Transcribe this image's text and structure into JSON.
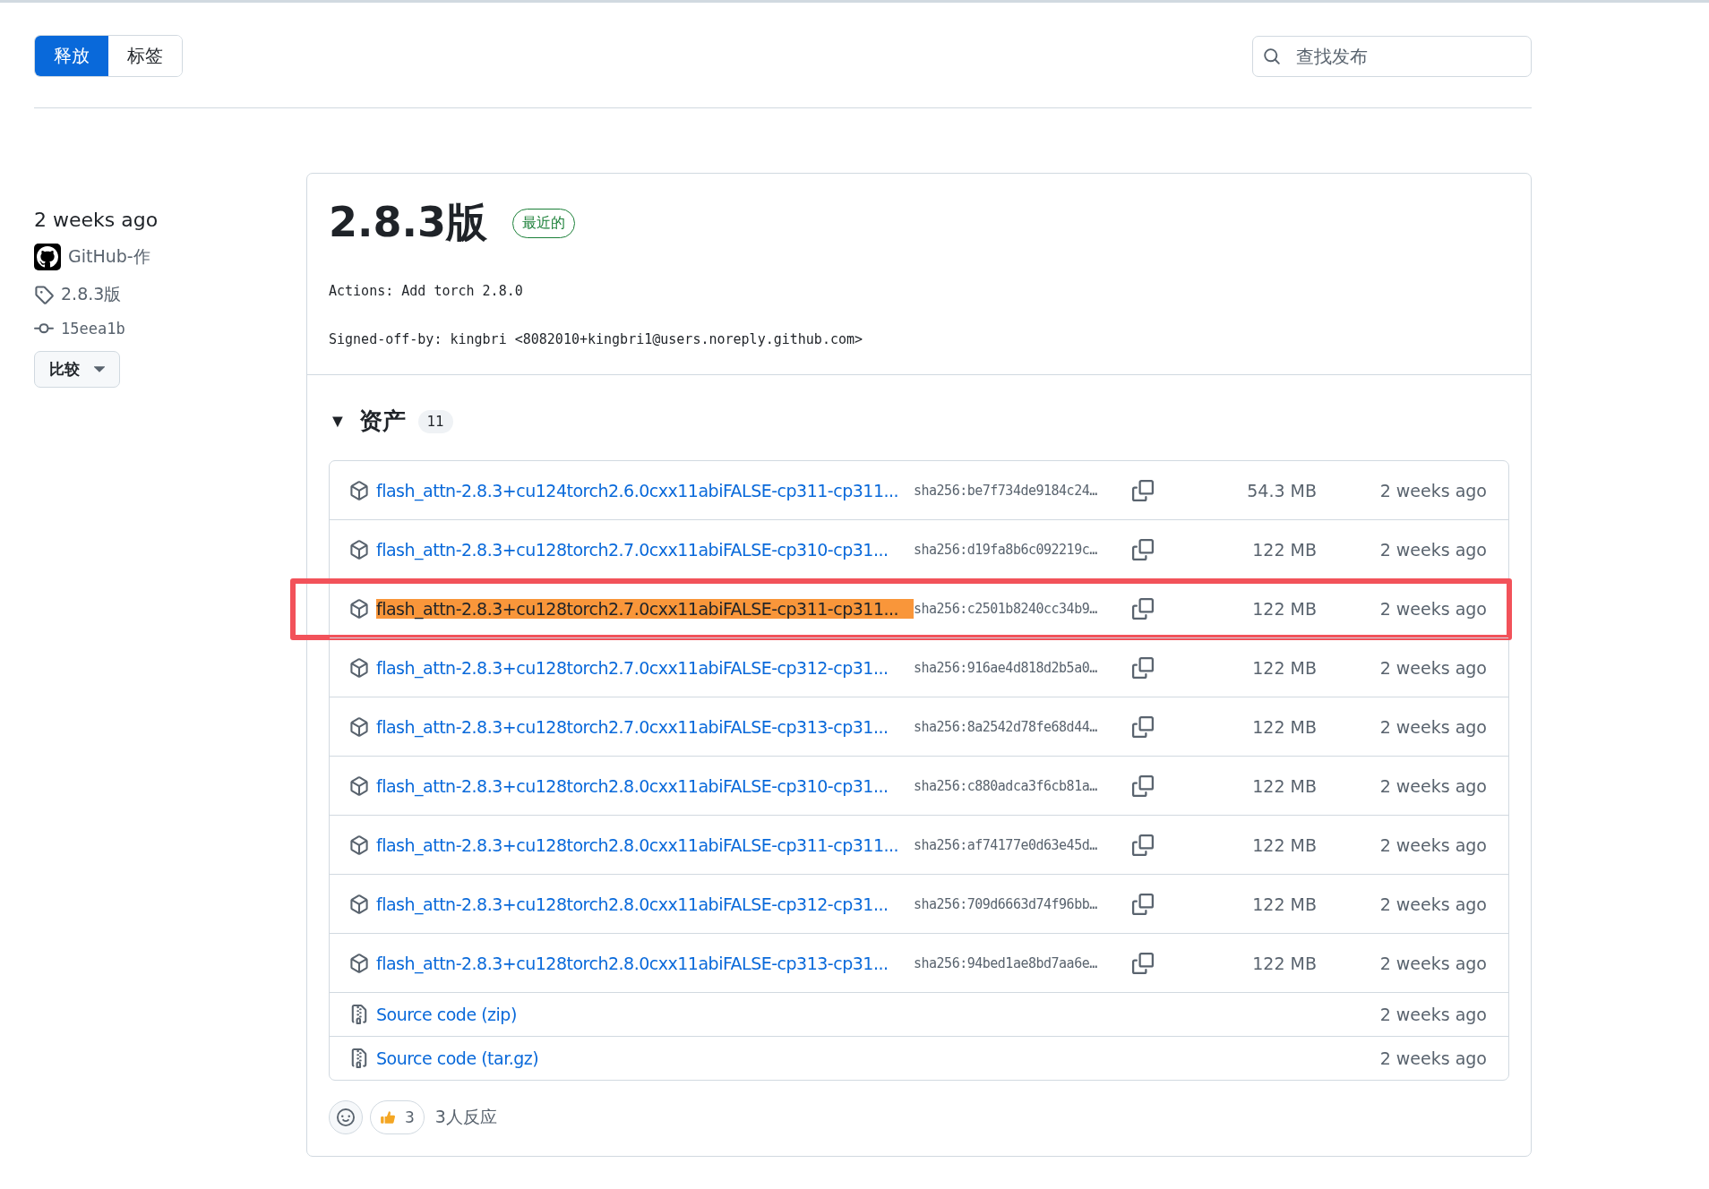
{
  "tabs": [
    {
      "label": "释放",
      "selected": true
    },
    {
      "label": "标签",
      "selected": false
    }
  ],
  "search": {
    "placeholder": "查找发布"
  },
  "sidebar": {
    "date": "2 weeks ago",
    "author": "GitHub-作",
    "tag": "2.8.3版",
    "commit": "15eea1b",
    "compare_button": "比较"
  },
  "release": {
    "title": "2.8.3版",
    "badge": "最近的",
    "body": [
      "Actions: Add torch 2.8.0",
      "Signed-off-by: kingbri <8082010+kingbri1@users.noreply.github.com>"
    ],
    "assets": {
      "toggle": "▼",
      "heading": "资产",
      "count": "11",
      "items": [
        {
          "kind": "package",
          "name": "flash_attn-2.8.3+cu124torch2.6.0cxx11abiFALSE-cp311-cp311...",
          "hash": "sha256:be7f734de9184c24…",
          "size": "54.3 MB",
          "time": "2 weeks ago",
          "highlighted": false,
          "framed": false
        },
        {
          "kind": "package",
          "name": "flash_attn-2.8.3+cu128torch2.7.0cxx11abiFALSE-cp310-cp31...",
          "hash": "sha256:d19fa8b6c092219c…",
          "size": "122 MB",
          "time": "2 weeks ago",
          "highlighted": false,
          "framed": false
        },
        {
          "kind": "package",
          "name": "flash_attn-2.8.3+cu128torch2.7.0cxx11abiFALSE-cp311-cp311...",
          "hash": "sha256:c2501b8240cc34b9…",
          "size": "122 MB",
          "time": "2 weeks ago",
          "highlighted": true,
          "framed": true
        },
        {
          "kind": "package",
          "name": "flash_attn-2.8.3+cu128torch2.7.0cxx11abiFALSE-cp312-cp31...",
          "hash": "sha256:916ae4d818d2b5a0…",
          "size": "122 MB",
          "time": "2 weeks ago",
          "highlighted": false,
          "framed": false
        },
        {
          "kind": "package",
          "name": "flash_attn-2.8.3+cu128torch2.7.0cxx11abiFALSE-cp313-cp31...",
          "hash": "sha256:8a2542d78fe68d44…",
          "size": "122 MB",
          "time": "2 weeks ago",
          "highlighted": false,
          "framed": false
        },
        {
          "kind": "package",
          "name": "flash_attn-2.8.3+cu128torch2.8.0cxx11abiFALSE-cp310-cp31...",
          "hash": "sha256:c880adca3f6cb81a…",
          "size": "122 MB",
          "time": "2 weeks ago",
          "highlighted": false,
          "framed": false
        },
        {
          "kind": "package",
          "name": "flash_attn-2.8.3+cu128torch2.8.0cxx11abiFALSE-cp311-cp311...",
          "hash": "sha256:af74177e0d63e45d…",
          "size": "122 MB",
          "time": "2 weeks ago",
          "highlighted": false,
          "framed": false
        },
        {
          "kind": "package",
          "name": "flash_attn-2.8.3+cu128torch2.8.0cxx11abiFALSE-cp312-cp31...",
          "hash": "sha256:709d6663d74f96bb…",
          "size": "122 MB",
          "time": "2 weeks ago",
          "highlighted": false,
          "framed": false
        },
        {
          "kind": "package",
          "name": "flash_attn-2.8.3+cu128torch2.8.0cxx11abiFALSE-cp313-cp31...",
          "hash": "sha256:94bed1ae8bd7aa6e…",
          "size": "122 MB",
          "time": "2 weeks ago",
          "highlighted": false,
          "framed": false
        },
        {
          "kind": "source",
          "name": "Source code (zip)",
          "time": "2 weeks ago"
        },
        {
          "kind": "source",
          "name": "Source code (tar.gz)",
          "time": "2 weeks ago"
        }
      ]
    },
    "reactions": {
      "thumbs_up_count": "3",
      "summary": "3人反应"
    }
  }
}
